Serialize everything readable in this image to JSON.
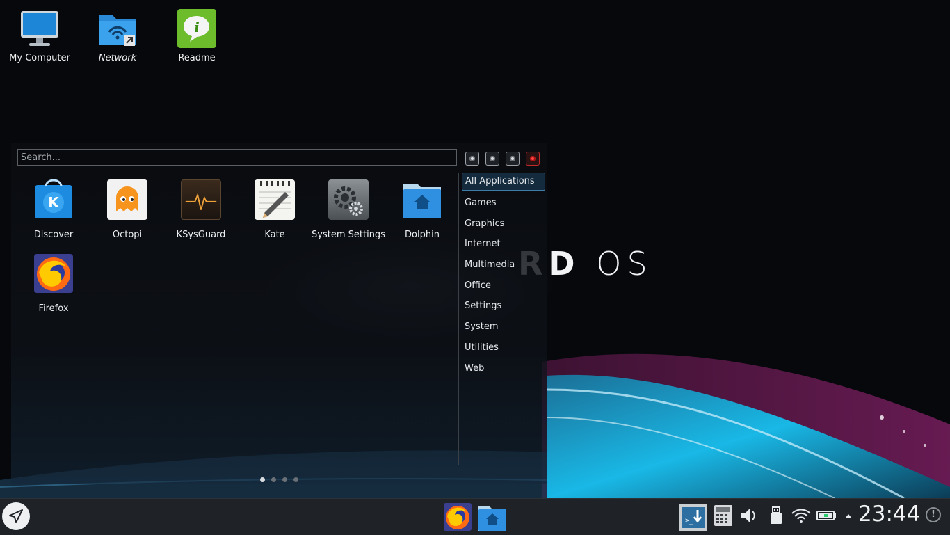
{
  "desktop": {
    "icons": [
      {
        "label": "My Computer",
        "icon": "monitor-icon"
      },
      {
        "label": "Network",
        "icon": "network-folder-icon"
      },
      {
        "label": "Readme",
        "icon": "info-icon"
      }
    ],
    "wallpaper_brand": {
      "bold": "RD",
      "light": "OS"
    }
  },
  "launcher": {
    "search_placeholder": "Search...",
    "session_buttons": [
      "lock-icon",
      "logout-icon",
      "suspend-icon",
      "shutdown-icon"
    ],
    "apps": [
      {
        "label": "Discover",
        "icon": "discover-icon"
      },
      {
        "label": "Octopi",
        "icon": "octopi-icon"
      },
      {
        "label": "KSysGuard",
        "icon": "ksysguard-icon"
      },
      {
        "label": "Kate",
        "icon": "kate-icon"
      },
      {
        "label": "System Settings",
        "icon": "system-settings-icon"
      },
      {
        "label": "Dolphin",
        "icon": "dolphin-icon"
      },
      {
        "label": "Firefox",
        "icon": "firefox-icon"
      }
    ],
    "categories": [
      "All Applications",
      "Games",
      "Graphics",
      "Internet",
      "Multimedia",
      "Office",
      "Settings",
      "System",
      "Utilities",
      "Web"
    ],
    "active_category": "All Applications",
    "page_count": 4,
    "current_page": 1
  },
  "taskbar": {
    "start_icon": "launcher-icon",
    "tasks": [
      "firefox-icon",
      "dolphin-icon"
    ],
    "tray": [
      "konsole-download-icon",
      "calculator-icon",
      "volume-icon",
      "usb-device-icon",
      "wifi-icon",
      "battery-icon",
      "expand-arrow-icon"
    ],
    "clock": "23:44",
    "notifications": "!"
  },
  "colors": {
    "accent": "#3daee9",
    "panel": "#1f2327"
  }
}
